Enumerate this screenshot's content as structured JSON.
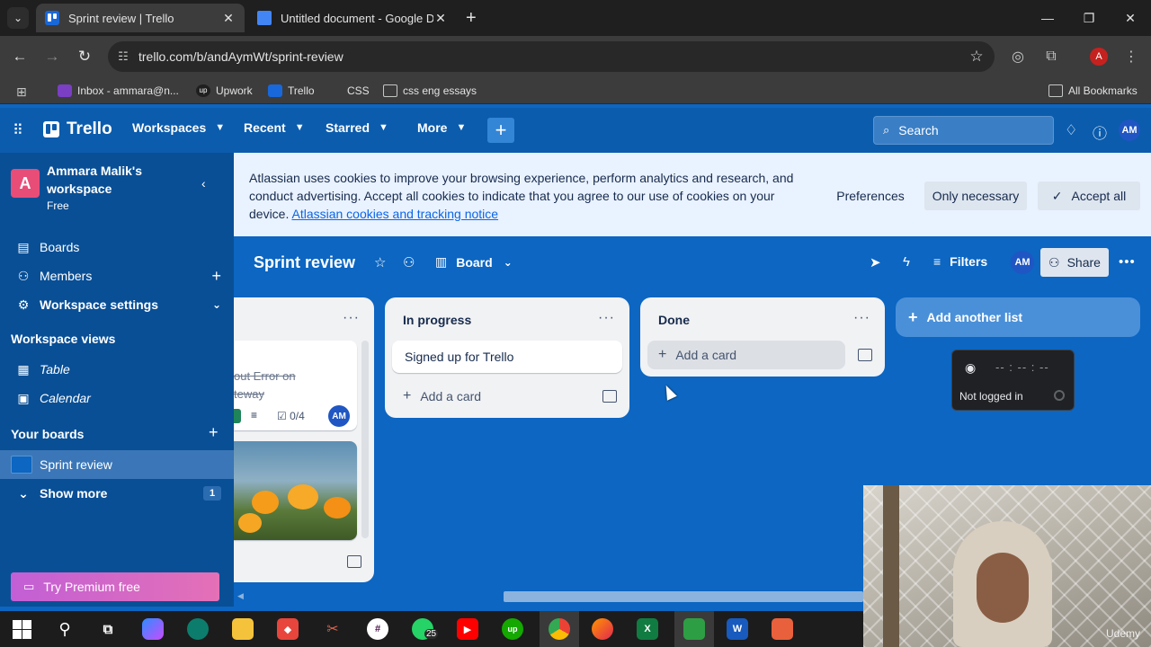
{
  "browser": {
    "tabs": [
      {
        "title": "Sprint review | Trello",
        "active": true
      },
      {
        "title": "Untitled document - Google Do",
        "active": false
      }
    ],
    "url": "trello.com/b/andAymWt/sprint-review",
    "profile_initial": "A",
    "bookmarks": [
      {
        "label": "Inbox - ammara@n..."
      },
      {
        "label": "Upwork"
      },
      {
        "label": "Trello"
      },
      {
        "label": "CSS"
      },
      {
        "label": "css eng essays"
      }
    ],
    "all_bookmarks_label": "All Bookmarks"
  },
  "header": {
    "logo": "Trello",
    "menus": [
      "Workspaces",
      "Recent",
      "Starred",
      "More"
    ],
    "search_placeholder": "Search",
    "user_initials": "AM"
  },
  "sidebar": {
    "workspace_initial": "A",
    "workspace_name": "Ammara Malik's workspace",
    "workspace_plan": "Free",
    "items": [
      {
        "label": "Boards"
      },
      {
        "label": "Members"
      },
      {
        "label": "Workspace settings"
      }
    ],
    "views_heading": "Workspace views",
    "views": [
      {
        "label": "Table"
      },
      {
        "label": "Calendar"
      }
    ],
    "boards_heading": "Your boards",
    "current_board": "Sprint review",
    "show_more": "Show more",
    "show_more_count": "1",
    "premium": "Try Premium free"
  },
  "cookie": {
    "text": "Atlassian uses cookies to improve your browsing experience, perform analytics and research, and conduct advertising. Accept all cookies to indicate that you agree to our use of cookies on your device.",
    "link": "Atlassian cookies and tracking notice",
    "preferences": "Preferences",
    "only_necessary": "Only necessary",
    "accept_all": "Accept all"
  },
  "board": {
    "title": "Sprint review",
    "view": "Board",
    "filters": "Filters",
    "member_initials": "AM",
    "share": "Share"
  },
  "lists": {
    "partial": {
      "card_title_line1": "out Error on",
      "card_title_line2": "teway",
      "checklist": "0/4",
      "member": "AM"
    },
    "in_progress": {
      "title": "In progress",
      "card": "Signed up for Trello",
      "add_card": "Add a card"
    },
    "done": {
      "title": "Done",
      "add_card": "Add a card"
    },
    "add_another": "Add another list"
  },
  "timer": {
    "clock": "-- : -- : --",
    "status": "Not logged in"
  },
  "webcam": {
    "watermark": "Udemy"
  },
  "taskbar": {
    "whatsapp_badge": "25"
  },
  "colors": {
    "board_bg": "#0c66c2",
    "header_bg": "#0b5cad",
    "sidebar_bg": "#094f96",
    "workspace_badge": "#e84d78"
  }
}
